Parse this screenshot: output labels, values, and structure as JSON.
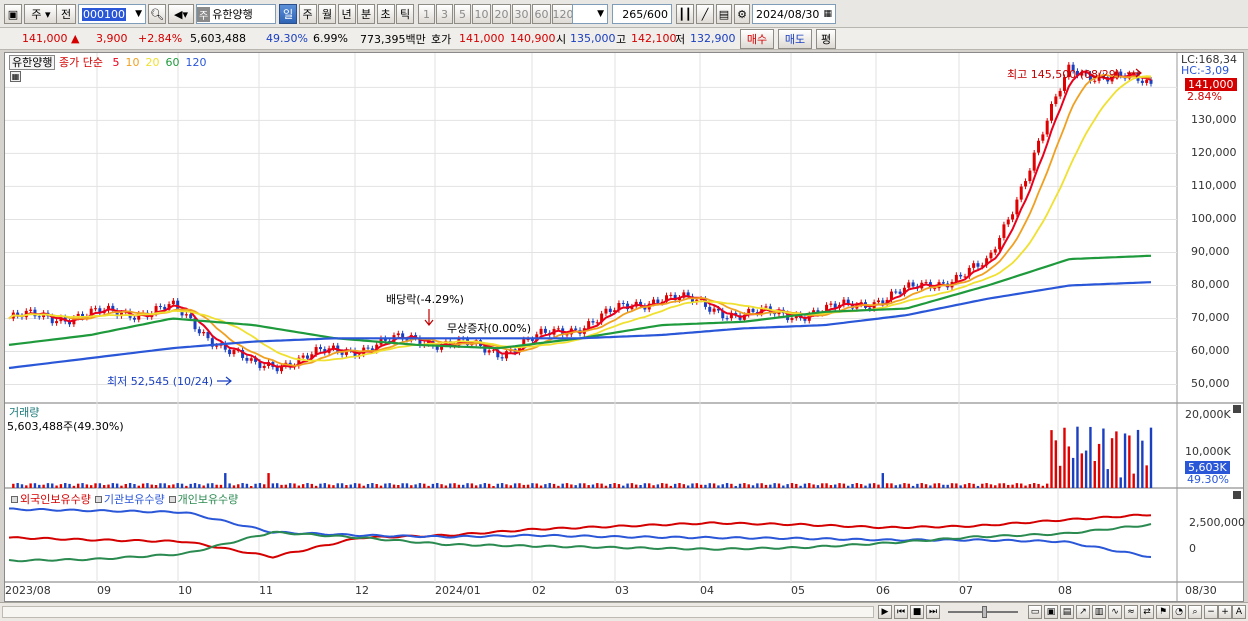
{
  "toolbar": {
    "market_btn": "주",
    "prev_btn": "전",
    "code": "000100",
    "stock_tag": "주",
    "stock_name": "유한양행",
    "periods": [
      {
        "label": "일",
        "active": true
      },
      {
        "label": "주",
        "active": false
      },
      {
        "label": "월",
        "active": false
      },
      {
        "label": "년",
        "active": false
      },
      {
        "label": "분",
        "active": false
      },
      {
        "label": "초",
        "active": false
      },
      {
        "label": "틱",
        "active": false
      }
    ],
    "intervals": [
      "1",
      "3",
      "5",
      "10",
      "20",
      "30",
      "60",
      "120"
    ],
    "count": "265",
    "count_total": "/600",
    "date": "2024/08/30"
  },
  "quote": {
    "price": "141,000",
    "change": "3,900",
    "change_pct": "+2.84%",
    "volume": "5,603,488",
    "vol_ratio": "49.30%",
    "turnover": "6.99%",
    "amount": "773,395백만",
    "ask_label": "호가",
    "ask": "141,000",
    "bid": "140,900",
    "open_label": "시",
    "open": "135,000",
    "high_label": "고",
    "high": "142,100",
    "low_label": "저",
    "low": "132,900",
    "buy_btn": "매수",
    "sell_btn": "매도",
    "eval_btn": "평"
  },
  "price_panel": {
    "stock_tag": "유한양행",
    "ma_label": "종가 단순",
    "ma_periods": [
      "5",
      "10",
      "20",
      "60",
      "120"
    ],
    "ma_colors": [
      "#e8001c",
      "#f0a020",
      "#f0e030",
      "#1e9a3c",
      "#2a56d8"
    ],
    "lc": "LC:168,34",
    "hc": "HC:-3,09",
    "current_price": "141,000",
    "current_pct": "2.84%",
    "high_note": "최고 145,500 (08/29)",
    "low_note": "최저 52,545 (10/24)",
    "dividend_note": "배당락(-4.29%)",
    "bonus_note": "무상증자(0.00%)",
    "y_ticks": [
      "140,000",
      "130,000",
      "120,000",
      "110,000",
      "100,000",
      "90,000",
      "80,000",
      "70,000",
      "60,000",
      "50,000"
    ]
  },
  "volume_panel": {
    "title": "거래량",
    "value": "5,603,488주(49.30%)",
    "y_ticks": [
      "20,000K",
      "10,000K"
    ],
    "current": "5,603K",
    "current_pct": "49.30%"
  },
  "holdings_panel": {
    "series": [
      {
        "name": "외국인보유수량",
        "color": "#d40000"
      },
      {
        "name": "기관보유수량",
        "color": "#2a56d8"
      },
      {
        "name": "개인보유수량",
        "color": "#2a8a50"
      }
    ],
    "y_ticks": [
      "2,500,000",
      "0"
    ]
  },
  "x_axis": [
    "2023/08",
    "09",
    "10",
    "11",
    "12",
    "2024/01",
    "02",
    "03",
    "04",
    "05",
    "06",
    "07",
    "08",
    "08/30"
  ],
  "chart_data": {
    "type": "line",
    "title": "유한양행",
    "ylim": [
      45000,
      148000
    ],
    "x": [
      "2023/08",
      "09",
      "10",
      "11",
      "12",
      "2024/01",
      "02",
      "03",
      "04",
      "05",
      "06",
      "07",
      "08",
      "08/29",
      "08/30"
    ],
    "series": [
      {
        "name": "종가",
        "values": [
          70000,
          71000,
          73000,
          55000,
          60000,
          64000,
          60000,
          68000,
          77000,
          71000,
          72000,
          78000,
          86000,
          145500,
          141000
        ]
      },
      {
        "name": "60",
        "values": [
          62000,
          65000,
          70000,
          68000,
          64000,
          62000,
          61000,
          64000,
          68000,
          69000,
          72000,
          73000,
          80000,
          88000,
          89000
        ]
      },
      {
        "name": "120",
        "values": [
          55000,
          58000,
          61000,
          63000,
          64000,
          64000,
          64000,
          64000,
          65000,
          67000,
          68000,
          71000,
          76000,
          80000,
          81000
        ]
      }
    ]
  }
}
